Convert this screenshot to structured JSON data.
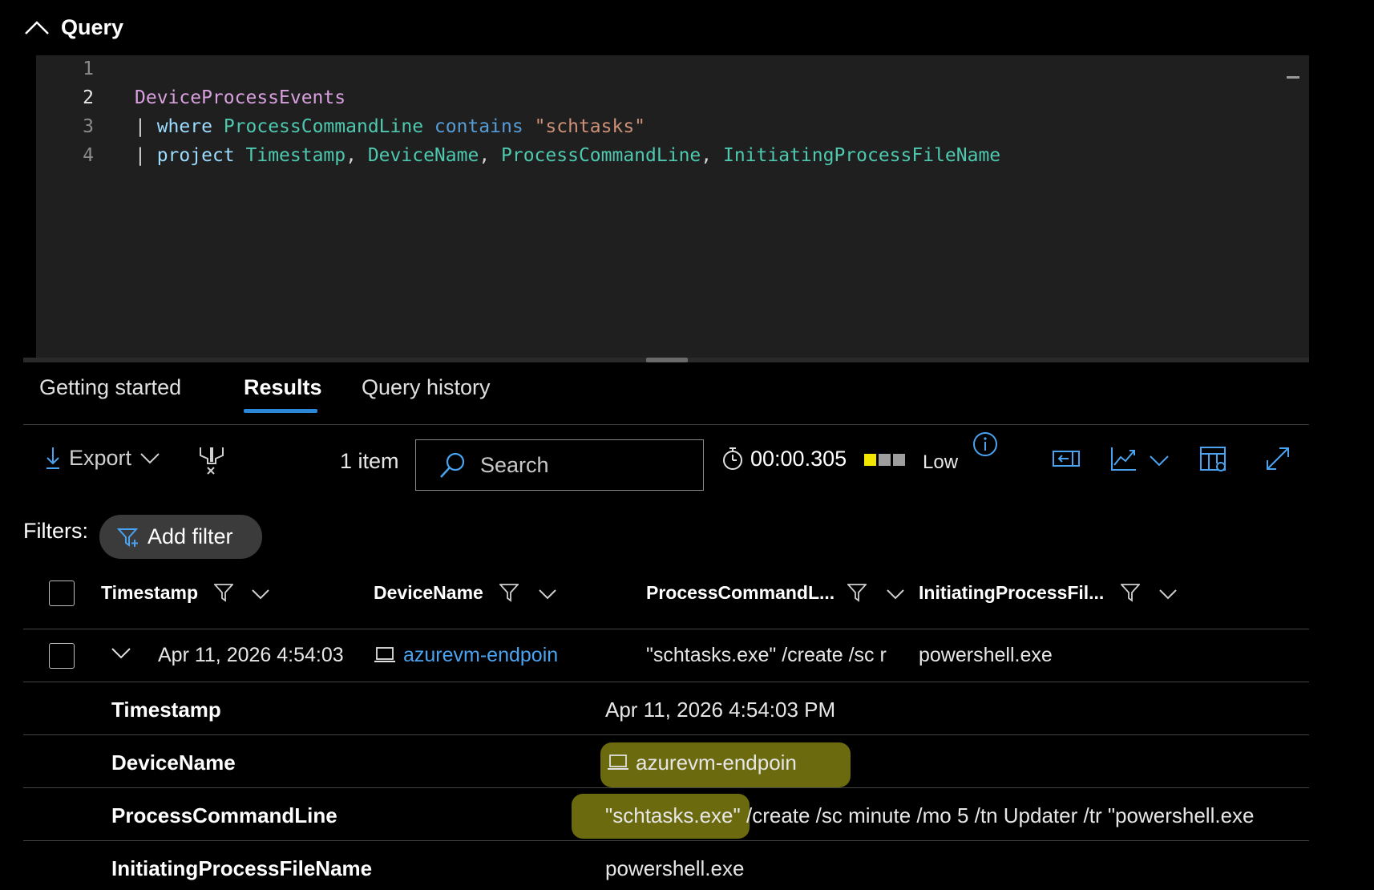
{
  "query": {
    "title": "Query",
    "line_numbers": [
      "1",
      "2",
      "3",
      "4"
    ],
    "lines": [
      [],
      [
        {
          "t": "DeviceProcessEvents",
          "c": "table"
        }
      ],
      [
        {
          "t": "| ",
          "c": "pipe"
        },
        {
          "t": "where",
          "c": "kw"
        },
        {
          "t": " ",
          "c": "pipe"
        },
        {
          "t": "ProcessCommandLine",
          "c": "col"
        },
        {
          "t": " ",
          "c": "pipe"
        },
        {
          "t": "contains",
          "c": "op"
        },
        {
          "t": " ",
          "c": "pipe"
        },
        {
          "t": "\"schtasks\"",
          "c": "str"
        }
      ],
      [
        {
          "t": "| ",
          "c": "pipe"
        },
        {
          "t": "project",
          "c": "kw"
        },
        {
          "t": " ",
          "c": "pipe"
        },
        {
          "t": "Timestamp",
          "c": "col"
        },
        {
          "t": ", ",
          "c": "pipe"
        },
        {
          "t": "DeviceName",
          "c": "col"
        },
        {
          "t": ", ",
          "c": "pipe"
        },
        {
          "t": "ProcessCommandLine",
          "c": "col"
        },
        {
          "t": ", ",
          "c": "pipe"
        },
        {
          "t": "InitiatingProcessFileName",
          "c": "col"
        }
      ]
    ]
  },
  "tabs": {
    "getting_started": "Getting started",
    "results": "Results",
    "query_history": "Query history"
  },
  "toolbar": {
    "export_label": "Export",
    "item_count": "1 item",
    "search_placeholder": "Search",
    "elapsed": "00:00.305",
    "resource_usage": "Low",
    "usage_colors": [
      "#f2e600",
      "#9e9e9e",
      "#9e9e9e"
    ]
  },
  "filters": {
    "label": "Filters:",
    "add_filter": "Add filter"
  },
  "grid": {
    "columns": [
      "Timestamp",
      "DeviceName",
      "ProcessCommandL...",
      "InitiatingProcessFil..."
    ],
    "row": {
      "timestamp": "Apr 11, 2026 4:54:03",
      "device": "azurevm-endpoin",
      "command": "\"schtasks.exe\" /create /sc r",
      "initiating": "powershell.exe"
    },
    "details": {
      "timestamp_label": "Timestamp",
      "timestamp_value": "Apr 11, 2026 4:54:03 PM",
      "device_label": "DeviceName",
      "device_value": "azurevm-endpoin",
      "command_label": "ProcessCommandLine",
      "command_highlight": "\"schtasks.exe\"",
      "command_rest": " /create /sc minute /mo 5 /tn Updater /tr \"powershell.exe",
      "initiating_label": "InitiatingProcessFileName",
      "initiating_value": "powershell.exe"
    }
  },
  "colors": {
    "accent": "#2b88d8",
    "link": "#4aa3f0",
    "highlight": "#6b6a0e"
  }
}
